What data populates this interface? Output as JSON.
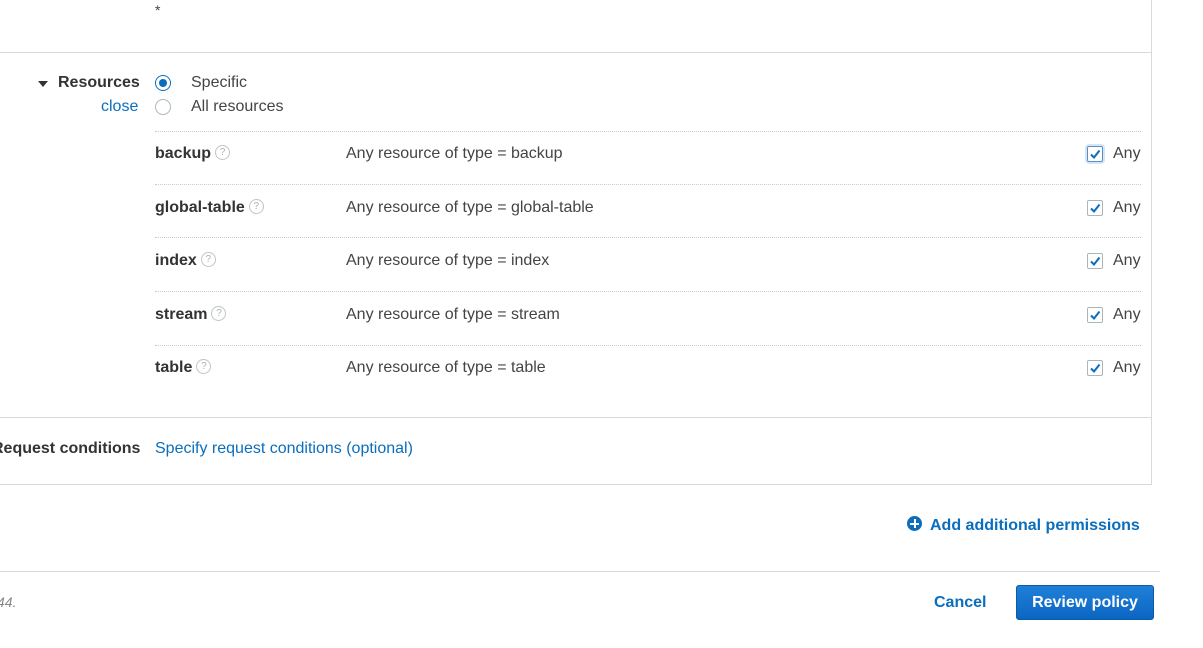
{
  "top": {
    "asterisk": "*"
  },
  "resources": {
    "label": "Resources",
    "close_link": "close",
    "options": [
      {
        "label": "Specific",
        "selected": true
      },
      {
        "label": "All resources",
        "selected": false
      }
    ],
    "help_glyph": "?",
    "rows": [
      {
        "name": "backup",
        "description": "Any resource of type = backup",
        "any_checked": true,
        "any_label": "Any"
      },
      {
        "name": "global-table",
        "description": "Any resource of type = global-table",
        "any_checked": true,
        "any_label": "Any"
      },
      {
        "name": "index",
        "description": "Any resource of type = index",
        "any_checked": true,
        "any_label": "Any"
      },
      {
        "name": "stream",
        "description": "Any resource of type = stream",
        "any_checked": true,
        "any_label": "Any"
      },
      {
        "name": "table",
        "description": "Any resource of type = table",
        "any_checked": true,
        "any_label": "Any"
      }
    ]
  },
  "request_conditions": {
    "label": "Request conditions",
    "link": "Specify request conditions (optional)"
  },
  "add_permissions": {
    "label": "Add additional permissions"
  },
  "footer": {
    "note": "44.",
    "cancel_label": "Cancel",
    "review_label": "Review policy"
  },
  "colors": {
    "accent": "#0a6ebd",
    "primary_button": "#0b66c2",
    "border": "#d5dbdb"
  }
}
